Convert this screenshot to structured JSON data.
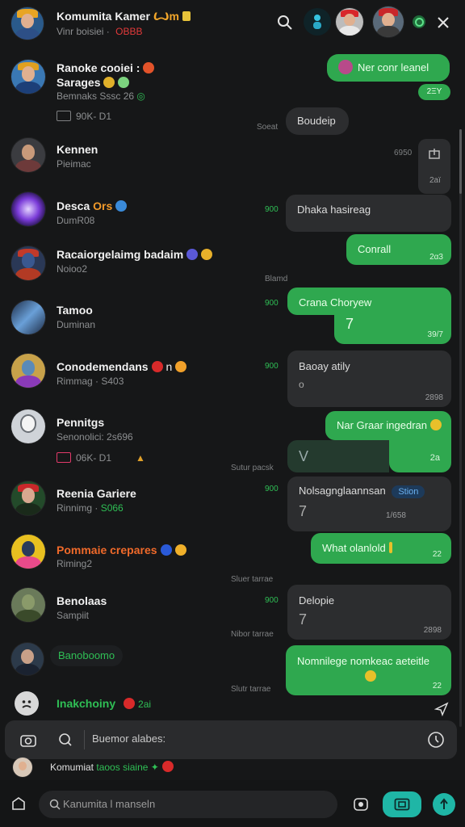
{
  "header": {
    "title": "Komumita Kamer",
    "title_badge": "Ꙍm",
    "subtitle": "Vinr boisiei ·",
    "subtitle_tag": "OBBB"
  },
  "top_bar_icons": [
    "search-icon",
    "figure-icon",
    "avatar-red-cap",
    "avatar-red-cap-2",
    "status-icon",
    "close-icon"
  ],
  "chats": [
    {
      "name": "Ranoke cooiei :",
      "name2": "Sarages",
      "sub": "Bemnaks  Sssc 26",
      "meta": "90K-  D1"
    },
    {
      "name": "Kennen",
      "sub": "Pieimac"
    },
    {
      "name": "Desca",
      "name_suffix": "Ors",
      "sub": "DumR08"
    },
    {
      "name": "Racaiorgelaimg badaim",
      "sub": "Noioo2"
    },
    {
      "name": "Tamoo",
      "sub": "Duminan"
    },
    {
      "name": "Conodemendans",
      "name_suffix": "n",
      "sub": "Rimmag  · S403"
    },
    {
      "name": "Pennitgs",
      "sub": "Senonolici:  2s696",
      "meta": "06K-  D1"
    },
    {
      "name": "Reenia Gariere",
      "sub": "Rinnimg ·",
      "sub_green": "S066"
    },
    {
      "name": "Pommaie crepares",
      "sub": "Riming2"
    },
    {
      "name": "Benolaas",
      "sub": "Sampiit"
    },
    {
      "name": "Banoboomo"
    },
    {
      "name": "Inakchoiny",
      "suffix": "2ai"
    }
  ],
  "messages": [
    {
      "dir": "out",
      "text": "Ner conr leanel",
      "time": "2ΞΥ"
    },
    {
      "dir": "in",
      "text": "Boudeip",
      "side": "Soeat"
    },
    {
      "dir": "in",
      "text": "",
      "side": "6950",
      "time": "2aï"
    },
    {
      "dir": "in",
      "text": "Dhaka hasireag",
      "gtime": "900"
    },
    {
      "dir": "out",
      "text": "Conrall",
      "time": "2α3"
    },
    {
      "dir": "label",
      "text": "Blamd"
    },
    {
      "dir": "out",
      "text": "Crana Choryew",
      "extra": "7",
      "time": "39/7",
      "gtime": "900"
    },
    {
      "dir": "in",
      "text": "Baoay atily",
      "extra": "o",
      "time": "2898",
      "gtime": "900"
    },
    {
      "dir": "out",
      "text": "Nar Graar ingedran",
      "time": "2a"
    },
    {
      "dir": "in",
      "text": "V",
      "side": "Sutur pacsk"
    },
    {
      "dir": "in",
      "text": "Nolsagnglaannsan",
      "tag": "Stion",
      "extra": "7",
      "time": "1/658",
      "gtime": "900"
    },
    {
      "dir": "out",
      "text": "What olanlold",
      "time": "22"
    },
    {
      "dir": "label",
      "text": "Sluer tarrae"
    },
    {
      "dir": "in",
      "text": "Delopie",
      "extra": "7",
      "time": "2898",
      "gtime": "900"
    },
    {
      "dir": "label",
      "text": "Nibor tarrae"
    },
    {
      "dir": "out",
      "text": "Nomnilege nomkeac aeteitle",
      "time": "22",
      "side": "Slutr tarrae"
    }
  ],
  "composer": {
    "placeholder": "Buemor alabes:"
  },
  "preview": {
    "name": "Komumiat",
    "text": "taoos siaine"
  },
  "bottom": {
    "search_placeholder": "Kanumita l manseln"
  },
  "colors": {
    "accent": "#2fa84f",
    "bg": "#161718",
    "bubble_in": "#2c2d2f",
    "teal": "#1fb6a6"
  }
}
